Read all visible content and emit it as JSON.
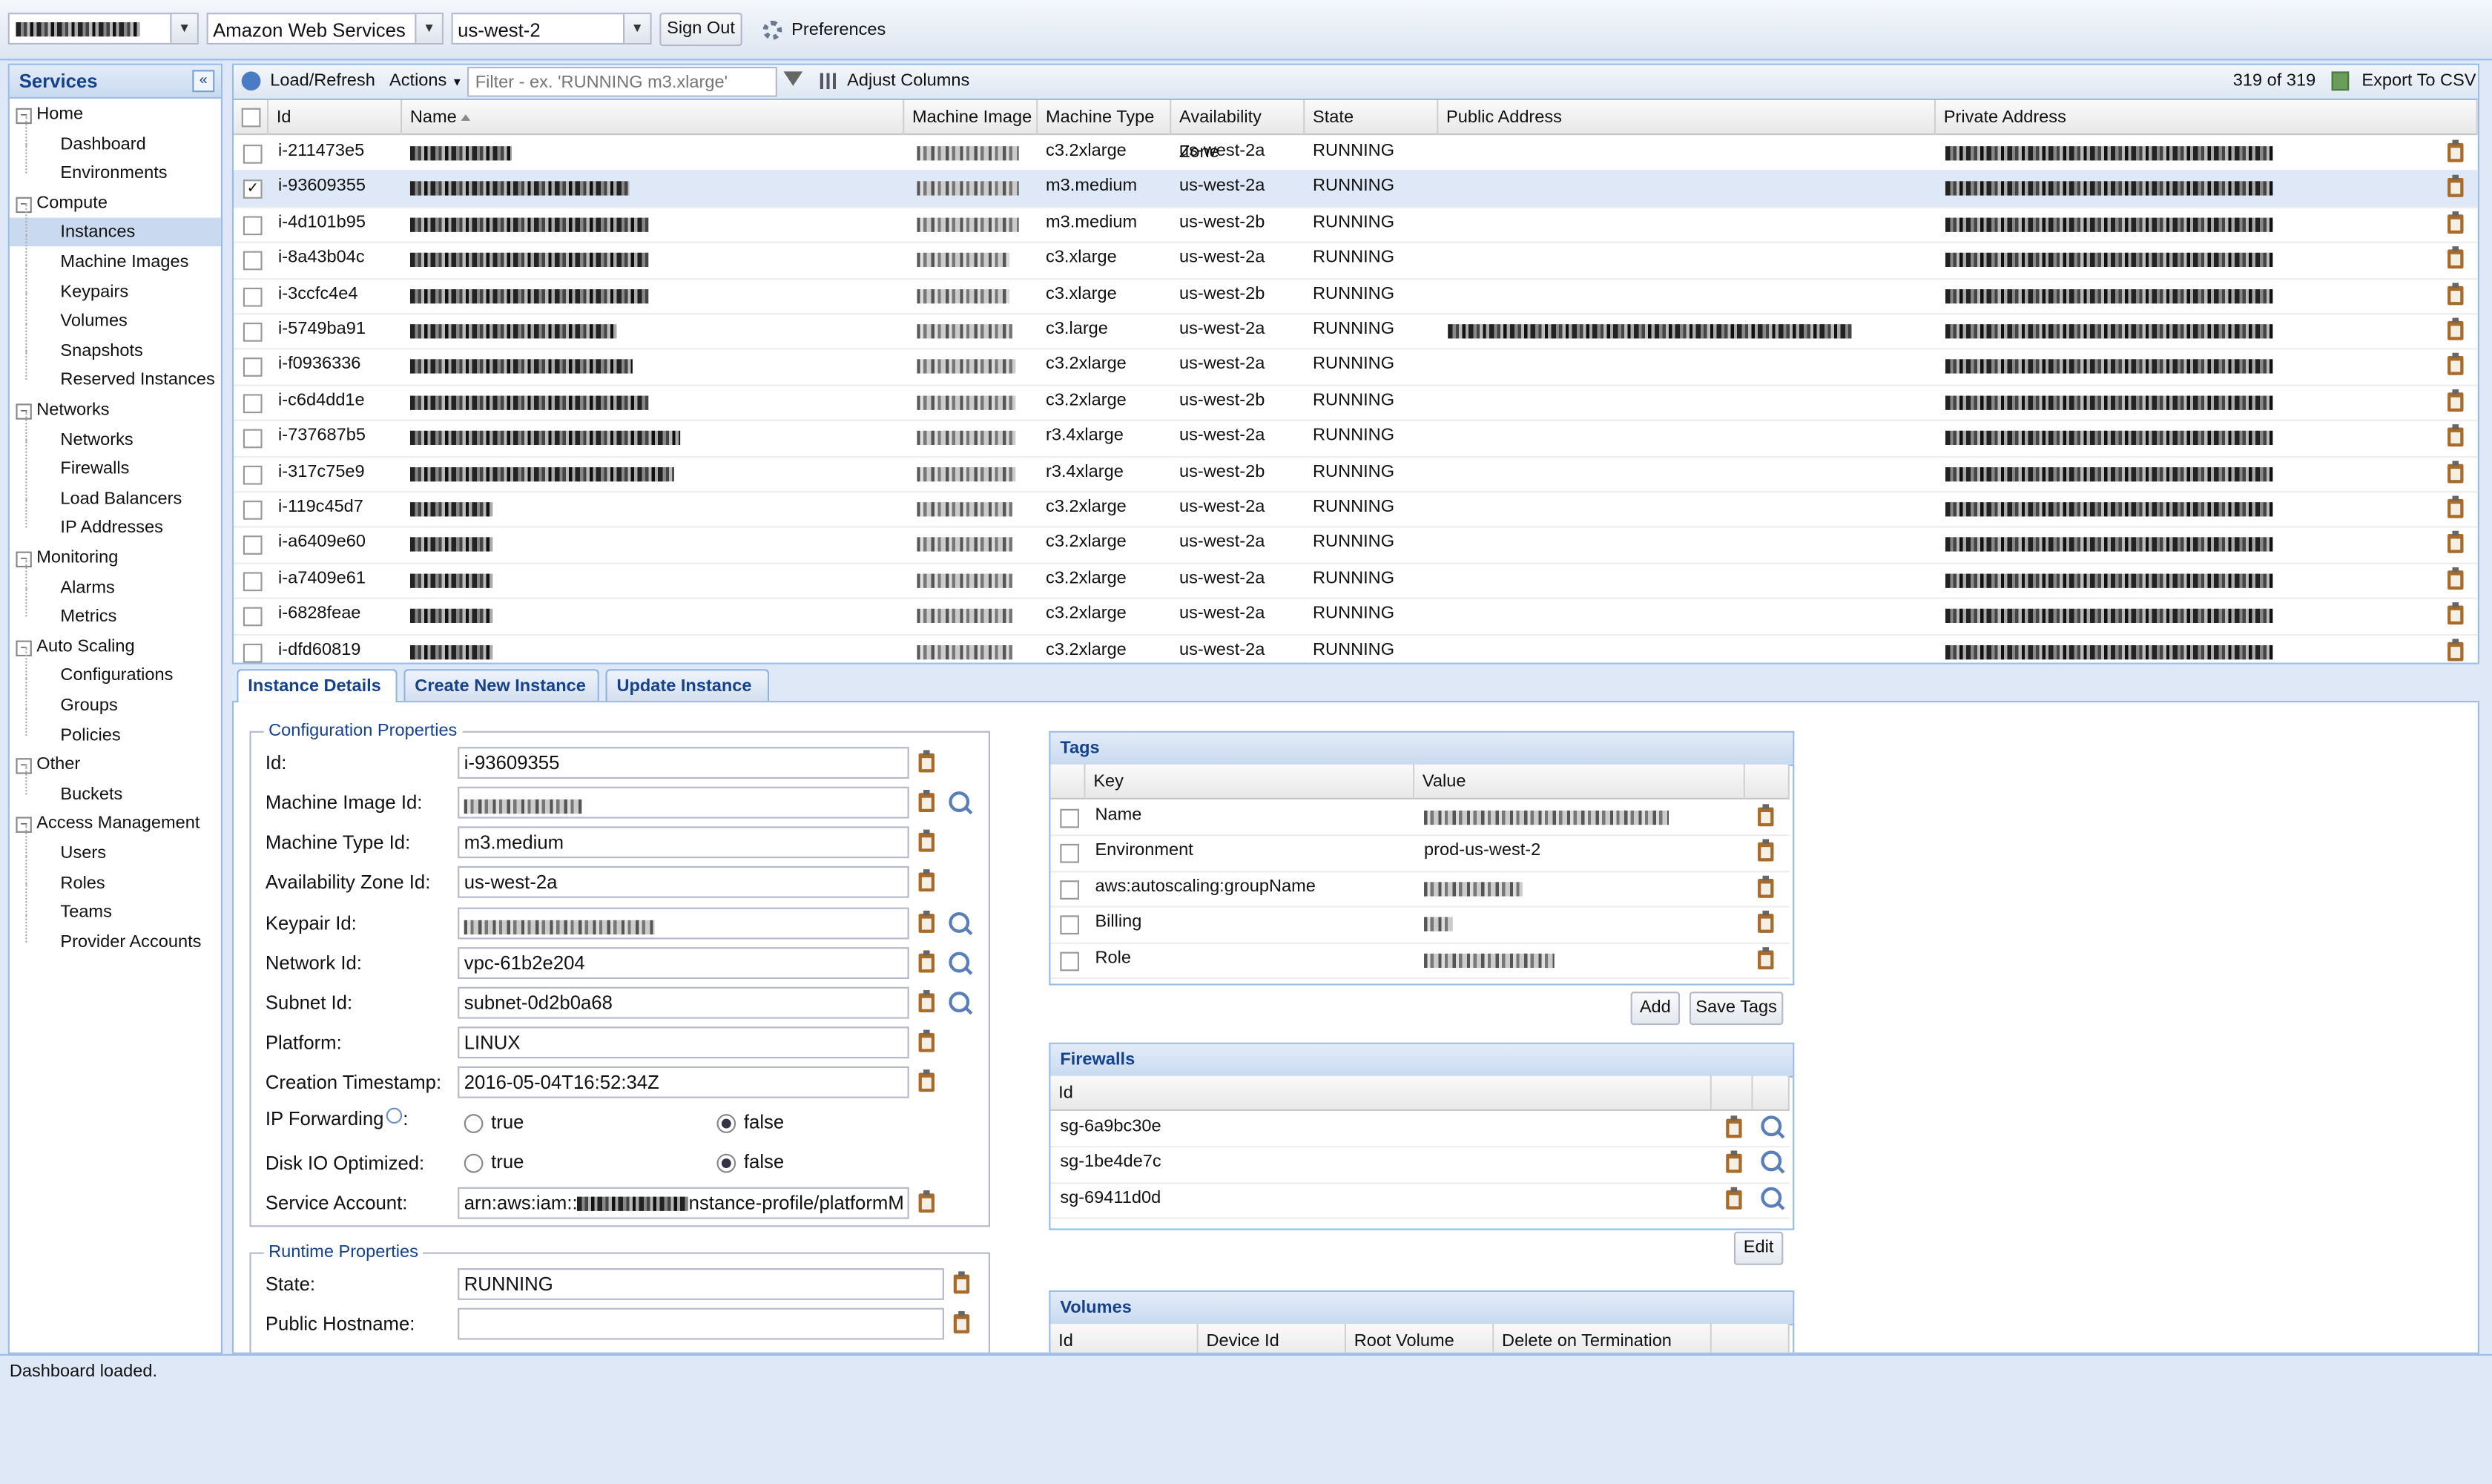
{
  "topbar": {
    "account": "",
    "cloud": "Amazon Web Services",
    "region": "us-west-2",
    "sign_out": "Sign Out",
    "preferences": "Preferences"
  },
  "sidebar": {
    "title": "Services",
    "groups": [
      {
        "label": "Home",
        "items": [
          "Dashboard",
          "Environments"
        ]
      },
      {
        "label": "Compute",
        "items": [
          "Instances",
          "Machine Images",
          "Keypairs",
          "Volumes",
          "Snapshots",
          "Reserved Instances"
        ]
      },
      {
        "label": "Networks",
        "items": [
          "Networks",
          "Firewalls",
          "Load Balancers",
          "IP Addresses"
        ]
      },
      {
        "label": "Monitoring",
        "items": [
          "Alarms",
          "Metrics"
        ]
      },
      {
        "label": "Auto Scaling",
        "items": [
          "Configurations",
          "Groups",
          "Policies"
        ]
      },
      {
        "label": "Other",
        "items": [
          "Buckets"
        ]
      },
      {
        "label": "Access Management",
        "items": [
          "Users",
          "Roles",
          "Teams",
          "Provider Accounts"
        ]
      }
    ],
    "selected": "Instances"
  },
  "toolbar": {
    "load_refresh": "Load/Refresh",
    "actions": "Actions",
    "filter_placeholder": "Filter - ex. 'RUNNING m3.xlarge'",
    "adjust_columns": "Adjust Columns",
    "count": "319 of 319",
    "export": "Export To CSV"
  },
  "grid": {
    "columns": [
      "Id",
      "Name",
      "Machine Image",
      "Machine Type",
      "Availability Zone",
      "State",
      "Public Address",
      "Private Address"
    ],
    "rows": [
      {
        "id": "i-211473e5",
        "type": "c3.2xlarge",
        "zone": "us-west-2a",
        "state": "RUNNING"
      },
      {
        "id": "i-93609355",
        "type": "m3.medium",
        "zone": "us-west-2a",
        "state": "RUNNING"
      },
      {
        "id": "i-4d101b95",
        "type": "m3.medium",
        "zone": "us-west-2b",
        "state": "RUNNING"
      },
      {
        "id": "i-8a43b04c",
        "type": "c3.xlarge",
        "zone": "us-west-2a",
        "state": "RUNNING"
      },
      {
        "id": "i-3ccfc4e4",
        "type": "c3.xlarge",
        "zone": "us-west-2b",
        "state": "RUNNING"
      },
      {
        "id": "i-5749ba91",
        "type": "c3.large",
        "zone": "us-west-2a",
        "state": "RUNNING"
      },
      {
        "id": "i-f0936336",
        "type": "c3.2xlarge",
        "zone": "us-west-2a",
        "state": "RUNNING"
      },
      {
        "id": "i-c6d4dd1e",
        "type": "c3.2xlarge",
        "zone": "us-west-2b",
        "state": "RUNNING"
      },
      {
        "id": "i-737687b5",
        "type": "r3.4xlarge",
        "zone": "us-west-2a",
        "state": "RUNNING"
      },
      {
        "id": "i-317c75e9",
        "type": "r3.4xlarge",
        "zone": "us-west-2b",
        "state": "RUNNING"
      },
      {
        "id": "i-119c45d7",
        "type": "c3.2xlarge",
        "zone": "us-west-2a",
        "state": "RUNNING"
      },
      {
        "id": "i-a6409e60",
        "type": "c3.2xlarge",
        "zone": "us-west-2a",
        "state": "RUNNING"
      },
      {
        "id": "i-a7409e61",
        "type": "c3.2xlarge",
        "zone": "us-west-2a",
        "state": "RUNNING"
      },
      {
        "id": "i-6828feae",
        "type": "c3.2xlarge",
        "zone": "us-west-2a",
        "state": "RUNNING"
      },
      {
        "id": "i-dfd60819",
        "type": "c3.2xlarge",
        "zone": "us-west-2a",
        "state": "RUNNING"
      }
    ]
  },
  "tabs": [
    "Instance Details",
    "Create New Instance",
    "Update Instance"
  ],
  "config": {
    "legend": "Configuration Properties",
    "id_label": "Id:",
    "id": "i-93609355",
    "image_label": "Machine Image Id:",
    "type_label": "Machine Type Id:",
    "type": "m3.medium",
    "zone_label": "Availability Zone Id:",
    "zone": "us-west-2a",
    "keypair_label": "Keypair Id:",
    "network_label": "Network Id:",
    "network": "vpc-61b2e204",
    "subnet_label": "Subnet Id:",
    "subnet": "subnet-0d2b0a68",
    "platform_label": "Platform:",
    "platform": "LINUX",
    "created_label": "Creation Timestamp:",
    "created": "2016-05-04T16:52:34Z",
    "ipfwd_label": "IP Forwarding",
    "diskio_label": "Disk IO Optimized:",
    "true_label": "true",
    "false_label": "false",
    "account_label": "Service Account:",
    "account_prefix": "arn:aws:iam::",
    "account_suffix": "nstance-profile/platformM"
  },
  "runtime": {
    "legend": "Runtime Properties",
    "state_label": "State:",
    "state": "RUNNING",
    "hostname_label": "Public Hostname:"
  },
  "tags": {
    "title": "Tags",
    "col_key": "Key",
    "col_value": "Value",
    "rows": [
      {
        "key": "Name"
      },
      {
        "key": "Environment",
        "value": "prod-us-west-2"
      },
      {
        "key": "aws:autoscaling:groupName"
      },
      {
        "key": "Billing"
      },
      {
        "key": "Role"
      }
    ],
    "add": "Add",
    "save": "Save Tags"
  },
  "firewalls": {
    "title": "Firewalls",
    "col_id": "Id",
    "rows": [
      "sg-6a9bc30e",
      "sg-1be4de7c",
      "sg-69411d0d"
    ],
    "edit": "Edit"
  },
  "volumes": {
    "title": "Volumes",
    "columns": [
      "Id",
      "Device Id",
      "Root Volume",
      "Delete on Termination"
    ]
  },
  "status": "Dashboard loaded."
}
